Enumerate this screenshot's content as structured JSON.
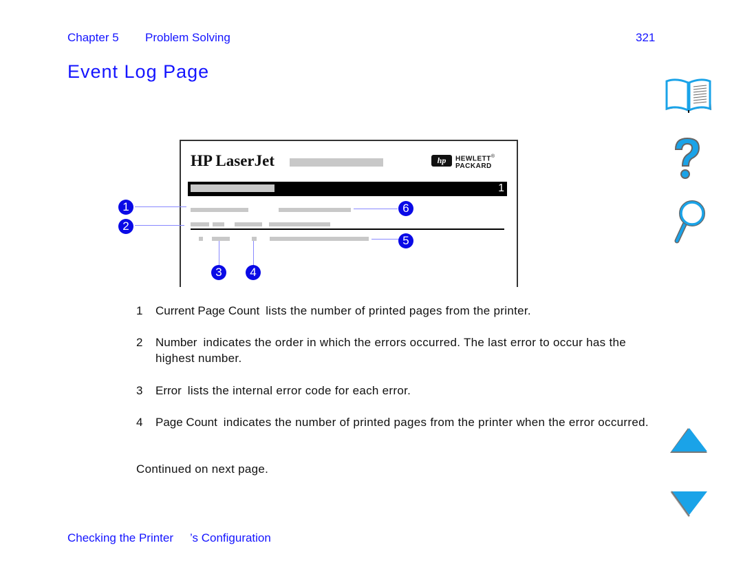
{
  "header": {
    "chapter": "Chapter 5",
    "section": "Problem Solving",
    "page_number": "321"
  },
  "title": "Event Log Page",
  "sample_page": {
    "product_name": "HP LaserJet",
    "logo_badge": "hp",
    "logo_line1": "HEWLETT",
    "logo_reg": "®",
    "logo_line2": "PACKARD",
    "band_number": "1",
    "callouts": [
      "1",
      "2",
      "3",
      "4",
      "5",
      "6"
    ]
  },
  "items": [
    {
      "number": "1",
      "term": "Current Page Count",
      "text": "lists the number of printed pages from the printer."
    },
    {
      "number": "2",
      "term": "Number",
      "text": "indicates the order in which the errors occurred. The last error to occur has the highest number."
    },
    {
      "number": "3",
      "term": "Error",
      "text": "lists the internal error code for each error."
    },
    {
      "number": "4",
      "term": "Page Count",
      "text": "indicates the number of printed pages from the printer when the error occurred."
    }
  ],
  "continued": "Continued on next page.",
  "footer": {
    "part1": "Checking the Printer",
    "part2": "’s Configuration"
  },
  "nav": {
    "book": "book-icon",
    "help": "help-icon",
    "search": "search-icon",
    "previous": "previous-page-icon",
    "next": "next-page-icon"
  },
  "colors": {
    "link_blue": "#1414ff",
    "icon_blue": "#1aa3e8",
    "callout_blue": "#0a0ae6"
  }
}
